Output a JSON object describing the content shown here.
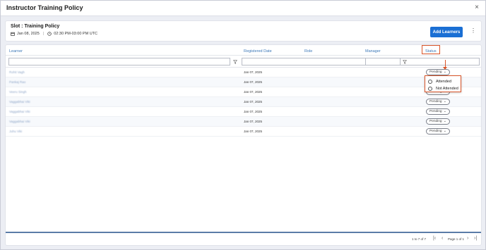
{
  "modal": {
    "title": "Instructor Training Policy",
    "close_glyph": "×"
  },
  "slot": {
    "title": "Slot : Training Policy",
    "date": "Jan 08, 2025",
    "time": "02:30 PM-03:00 PM UTC",
    "add_button": "Add Learners",
    "more_glyph": "⋮"
  },
  "table": {
    "columns": [
      "Learner",
      "Registered Date",
      "Role",
      "Manager",
      "Status"
    ],
    "rows": [
      {
        "learner": "Rohit Vagh",
        "date": "Jan 07, 2025",
        "status": "Pending"
      },
      {
        "learner": "Pankaj Rao",
        "date": "Jan 07, 2025",
        "status": "Pending"
      },
      {
        "learner": "Veeru Singh",
        "date": "Jan 07, 2025",
        "status": "Pending"
      },
      {
        "learner": "Vaggabhai Viki",
        "date": "Jan 07, 2025",
        "status": "Pending"
      },
      {
        "learner": "Vaggabhai Viki",
        "date": "Jan 07, 2025",
        "status": "Pending"
      },
      {
        "learner": "Vaggabhai Viki",
        "date": "Jan 07, 2025",
        "status": "Pending"
      },
      {
        "learner": "Juhu Viki",
        "date": "Jan 07, 2025",
        "status": "Pending"
      }
    ]
  },
  "status_dropdown": {
    "options": [
      "Attended",
      "Not Attended"
    ]
  },
  "footer": {
    "count": "1 to 7 of 7",
    "page_info": "Page 1 of 1",
    "first_glyph": "|‹",
    "prev_glyph": "‹",
    "next_glyph": "›",
    "last_glyph": "›|"
  },
  "colors": {
    "accent": "#1a6fd4",
    "annotation": "#d9552a",
    "header_text": "#3c78b8"
  }
}
